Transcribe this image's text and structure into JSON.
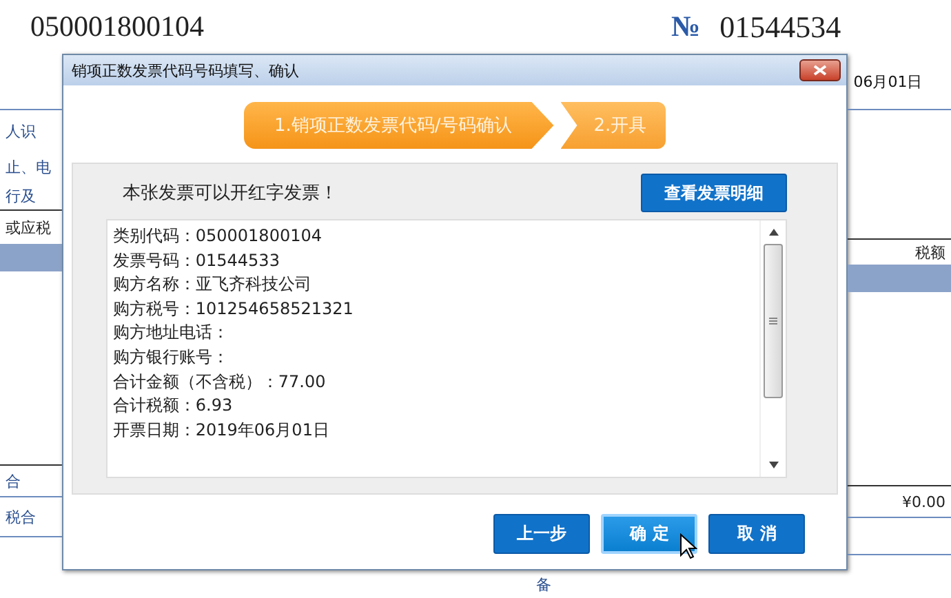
{
  "invoice": {
    "code": "050001800104",
    "number_sign": "№",
    "number": "01544534",
    "date": "06月01日",
    "left_fragments": [
      "人识",
      "止、电",
      "行及",
      "或应税",
      "合",
      "税合"
    ],
    "right_fragments": [
      "税额",
      "¥0.00"
    ],
    "bottom_fragment": "备"
  },
  "dialog": {
    "title": "销项正数发票代码号码填写、确认",
    "steps": [
      {
        "label": "1.销项正数发票代码/号码确认",
        "selected": true
      },
      {
        "label": "2.开具",
        "selected": false
      }
    ],
    "message": "本张发票可以开红字发票！",
    "detail_button": "查看发票明细",
    "lines": [
      "类别代码：050001800104",
      "发票号码：01544533",
      "购方名称：亚飞齐科技公司",
      "购方税号：101254658521321",
      "购方地址电话：",
      "购方银行账号：",
      "合计金额（不含税）：77.00",
      "合计税额：6.93",
      "开票日期：2019年06月01日"
    ],
    "buttons": [
      {
        "label": "上一步",
        "selected": false
      },
      {
        "label": "确 定",
        "selected": true
      },
      {
        "label": "取 消",
        "selected": false
      }
    ]
  }
}
